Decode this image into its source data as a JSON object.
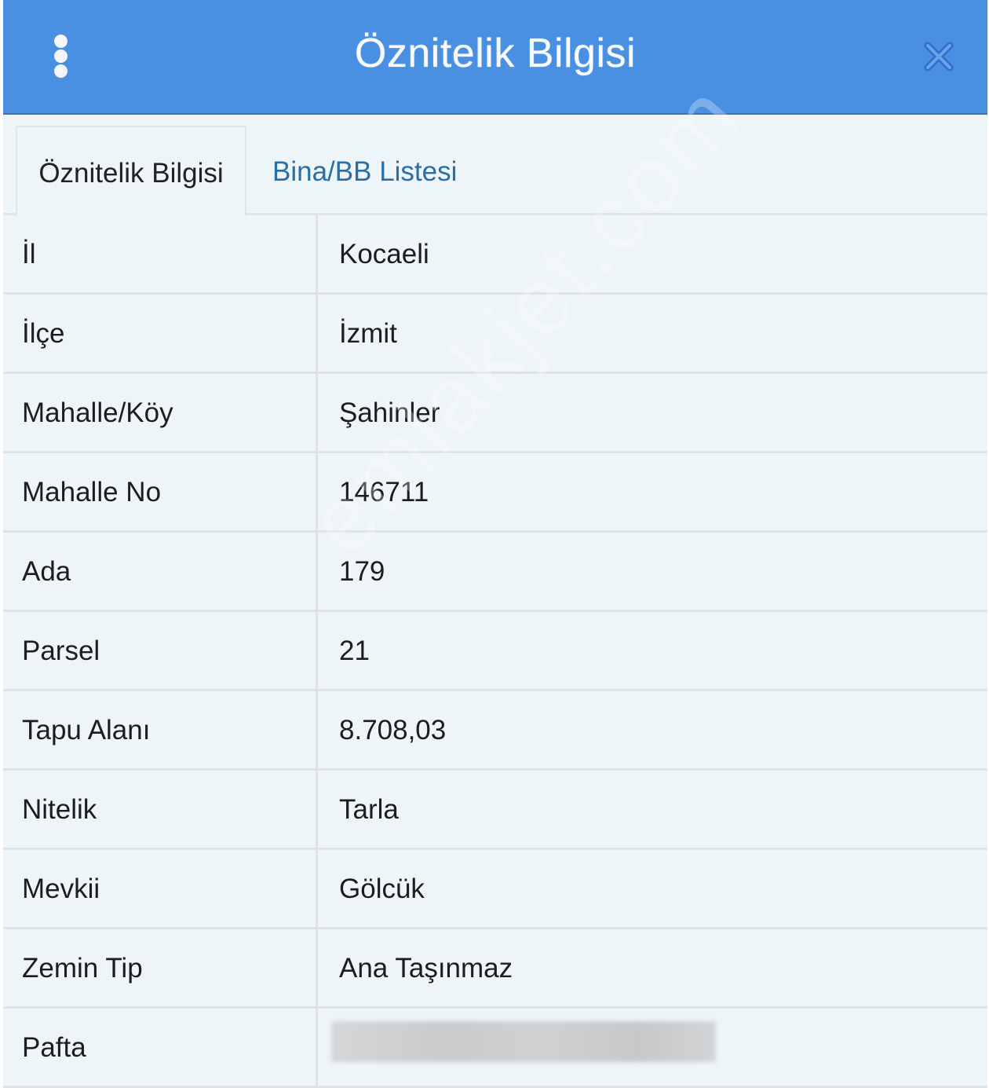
{
  "header": {
    "title": "Öznitelik Bilgisi",
    "menu_icon": "vertical-dots-icon",
    "close_icon": "close-x-icon",
    "bg_color": "#4a90e2"
  },
  "tabs": [
    {
      "label": "Öznitelik Bilgisi",
      "active": true
    },
    {
      "label": "Bina/BB Listesi",
      "active": false
    }
  ],
  "attributes": [
    {
      "label": "İl",
      "value": "Kocaeli"
    },
    {
      "label": "İlçe",
      "value": "İzmit"
    },
    {
      "label": "Mahalle/Köy",
      "value": "Şahinler"
    },
    {
      "label": "Mahalle No",
      "value": "146711"
    },
    {
      "label": "Ada",
      "value": "179"
    },
    {
      "label": "Parsel",
      "value": "21"
    },
    {
      "label": "Tapu Alanı",
      "value": "8.708,03"
    },
    {
      "label": "Nitelik",
      "value": "Tarla"
    },
    {
      "label": "Mevkii",
      "value": "Gölcük"
    },
    {
      "label": "Zemin Tip",
      "value": "Ana Taşınmaz"
    },
    {
      "label": "Pafta",
      "value": ""
    }
  ],
  "watermark": "emlakjet.com",
  "colors": {
    "tab_link": "#2b6da5",
    "panel_bg": "#eef5f9"
  }
}
